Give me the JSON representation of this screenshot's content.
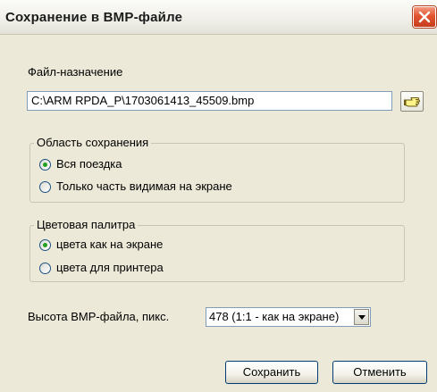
{
  "window": {
    "title": "Сохранение в BMP-файле"
  },
  "target": {
    "label": "Файл-назначение",
    "path": "C:\\ARM RPDA_P\\1703061413_45509.bmp"
  },
  "save_area": {
    "title": "Область сохранения",
    "options": [
      {
        "label": "Вся поездка",
        "selected": true
      },
      {
        "label": "Только часть видимая на экране",
        "selected": false
      }
    ]
  },
  "palette": {
    "title": "Цветовая палитра",
    "options": [
      {
        "label": "цвета как на экране",
        "selected": true
      },
      {
        "label": "цвета для принтера",
        "selected": false
      }
    ]
  },
  "height": {
    "label": "Высота BMP-файла, пикс.",
    "value": "478 (1:1 - как на экране)"
  },
  "buttons": {
    "save": "Сохранить",
    "cancel": "Отменить"
  },
  "icons": {
    "close": "close-icon",
    "browse": "pointing-hand-icon",
    "dropdown": "chevron-down-icon"
  },
  "colors": {
    "close_button": "#e2542f",
    "radio_dot": "#21a121",
    "dialog_bg": "#ece9d8"
  }
}
